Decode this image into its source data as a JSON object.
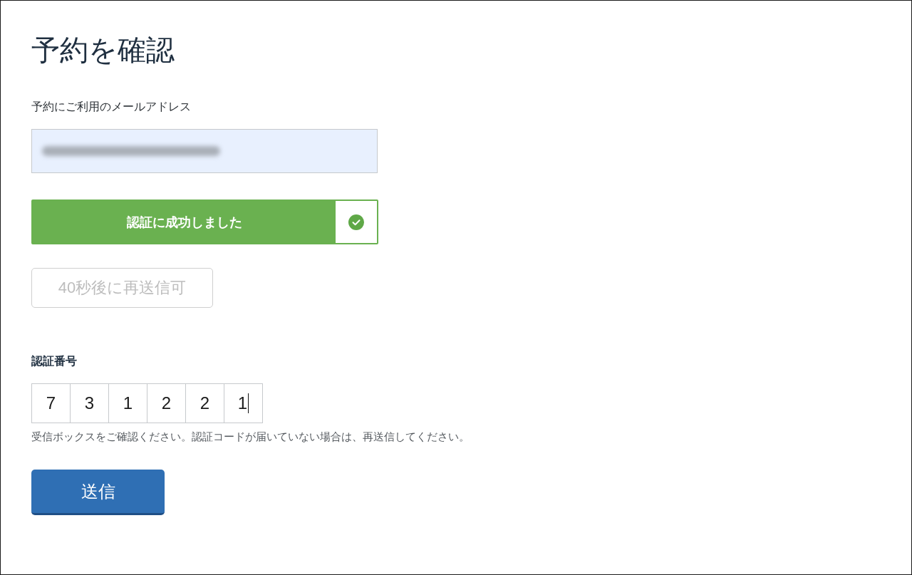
{
  "title": "予約を確認",
  "email_field": {
    "label": "予約にご利用のメールアドレス",
    "redacted": true
  },
  "verification_status": {
    "text": "認証に成功しました",
    "verified": true
  },
  "resend_button": {
    "label": "40秒後に再送信可",
    "disabled": true
  },
  "code_input": {
    "label": "認証番号",
    "digits": [
      {
        "value": "7",
        "focused": false
      },
      {
        "value": "3",
        "focused": false
      },
      {
        "value": "1",
        "focused": false
      },
      {
        "value": "2",
        "focused": false
      },
      {
        "value": "2",
        "focused": false
      },
      {
        "value": "1",
        "focused": true
      }
    ],
    "hint": "受信ボックスをご確認ください。認証コードが届いていない場合は、再送信してください。"
  },
  "submit_button": {
    "label": "送信"
  }
}
